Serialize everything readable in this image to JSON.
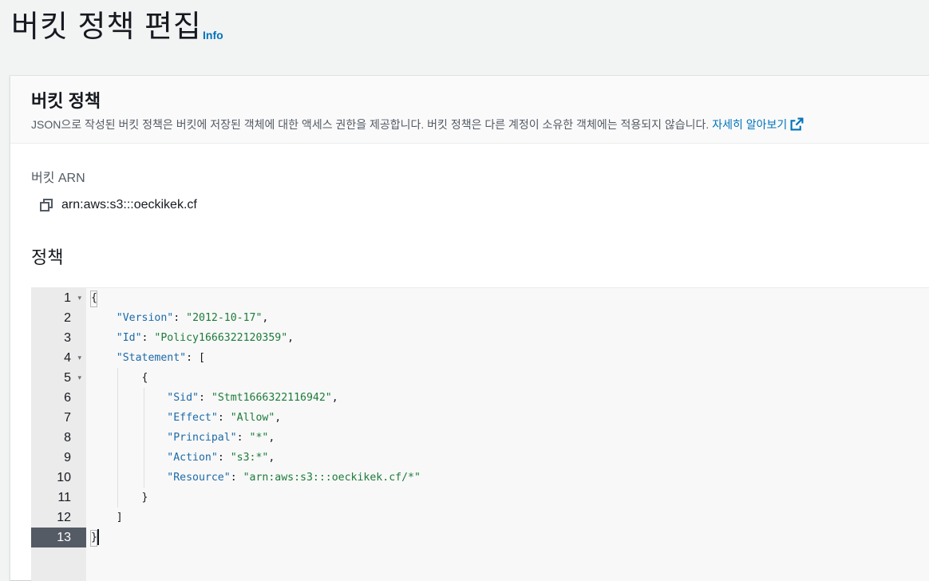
{
  "page": {
    "title": "버킷 정책 편집",
    "info_link": "Info"
  },
  "panel": {
    "title": "버킷 정책",
    "description": "JSON으로 작성된 버킷 정책은 버킷에 저장된 객체에 대한 액세스 권한을 제공합니다. 버킷 정책은 다른 계정이 소유한 객체에는 적용되지 않습니다.",
    "learn_more": "자세히 알아보기",
    "arn_label": "버킷 ARN",
    "arn_value": "arn:aws:s3:::oeckikek.cf",
    "policy_label": "정책"
  },
  "editor": {
    "active_line": 13,
    "lines": [
      {
        "n": "1",
        "fold": true
      },
      {
        "n": "2",
        "fold": false
      },
      {
        "n": "3",
        "fold": false
      },
      {
        "n": "4",
        "fold": true
      },
      {
        "n": "5",
        "fold": true
      },
      {
        "n": "6",
        "fold": false
      },
      {
        "n": "7",
        "fold": false
      },
      {
        "n": "8",
        "fold": false
      },
      {
        "n": "9",
        "fold": false
      },
      {
        "n": "10",
        "fold": false
      },
      {
        "n": "11",
        "fold": false
      },
      {
        "n": "12",
        "fold": false
      },
      {
        "n": "13",
        "fold": false
      }
    ],
    "code": {
      "l1": "{",
      "l2_key": "\"Version\"",
      "l2_val": "\"2012-10-17\"",
      "l3_key": "\"Id\"",
      "l3_val": "\"Policy1666322120359\"",
      "l4_key": "\"Statement\"",
      "l4_rest": ": [",
      "l5": "{",
      "l6_key": "\"Sid\"",
      "l6_val": "\"Stmt1666322116942\"",
      "l7_key": "\"Effect\"",
      "l7_val": "\"Allow\"",
      "l8_key": "\"Principal\"",
      "l8_val": "\"*\"",
      "l9_key": "\"Action\"",
      "l9_val": "\"s3:*\"",
      "l10_key": "\"Resource\"",
      "l10_val": "\"arn:aws:s3:::oeckikek.cf/*\"",
      "l11": "}",
      "l12": "]",
      "l13": "}"
    }
  },
  "colors": {
    "accent": "#0073bb",
    "json_key": "#1c6aa8",
    "json_string": "#1d7b3a",
    "gutter_active": "#545b64"
  }
}
